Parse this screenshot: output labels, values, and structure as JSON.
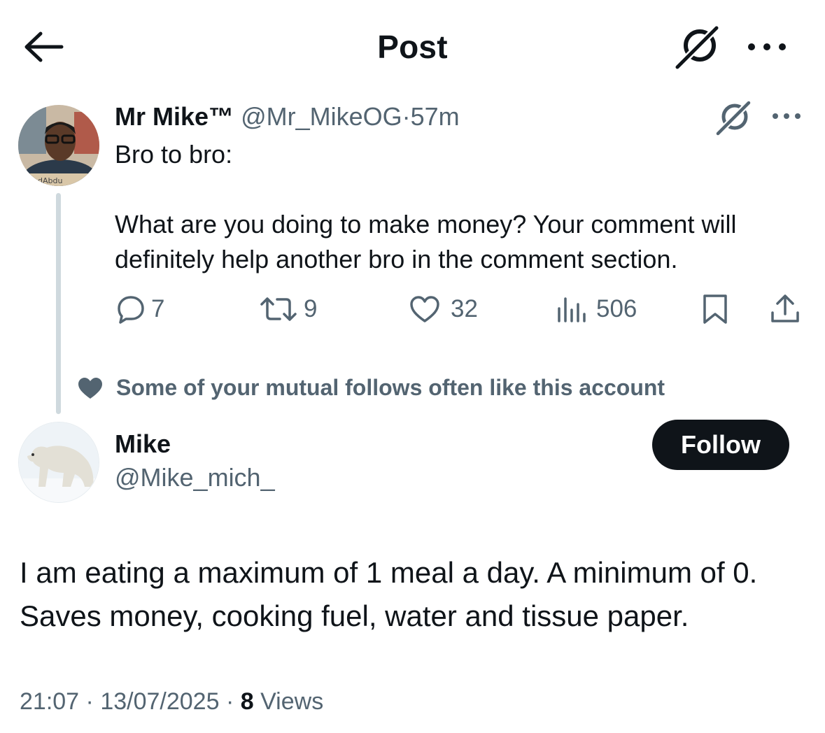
{
  "header": {
    "title": "Post",
    "icons": {
      "back": "arrow-left-icon",
      "grok": "grok-icon",
      "more": "more-horizontal-icon"
    }
  },
  "parent_tweet": {
    "display_name": "Mr Mike™",
    "handle": "@Mr_MikeOG",
    "separator": "·",
    "time": "57m",
    "text": "Bro to bro:\n\nWhat are you doing to make money? Your comment will definitely help another bro in the comment section.",
    "avatar_caption": "dAbdu",
    "actions": {
      "replies": "7",
      "reposts": "9",
      "likes": "32",
      "views": "506"
    }
  },
  "social_context": {
    "text": "Some of your mutual follows often like this account",
    "icon": "heart-filled-icon"
  },
  "reply": {
    "display_name": "Mike",
    "handle": "@Mike_mich_",
    "follow_label": "Follow",
    "text": "I am eating a maximum of 1 meal a day. A minimum of 0.\nSaves money, cooking fuel, water and tissue paper.",
    "meta": {
      "time": "21:07",
      "date": "13/07/2025",
      "separator": "·",
      "views_count": "8",
      "views_label": "Views"
    }
  },
  "colors": {
    "text_primary": "#0f1419",
    "text_secondary": "#536471",
    "thread_line": "#cfd9de",
    "button_bg": "#0f1419"
  }
}
